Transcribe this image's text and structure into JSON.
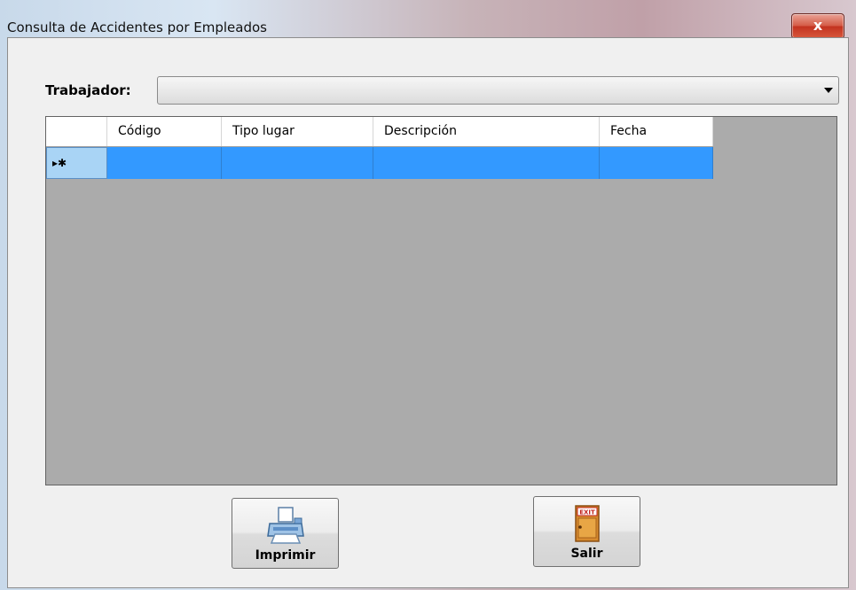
{
  "window": {
    "title": "Consulta de Accidentes por Empleados",
    "close_glyph": "x"
  },
  "filter": {
    "label": "Trabajador:",
    "selected_value": ""
  },
  "grid": {
    "columns": [
      "Código",
      "Tipo lugar",
      "Descripción",
      "Fecha"
    ],
    "new_row_indicator": "▸✱"
  },
  "buttons": {
    "print_label": "Imprimir",
    "exit_label": "Salir",
    "print_icon": "printer-icon",
    "exit_icon": "exit-door-icon",
    "exit_sign_text": "EXIT"
  },
  "colors": {
    "selection": "#3399ff",
    "grid_background": "#ababab"
  }
}
